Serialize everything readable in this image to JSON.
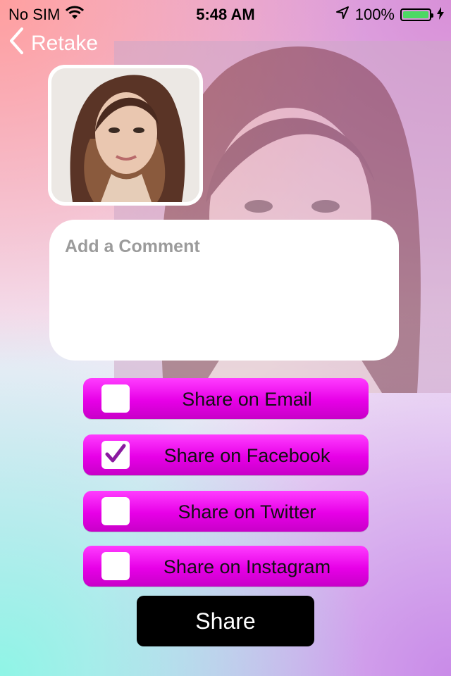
{
  "status": {
    "carrier": "No SIM",
    "time": "5:48 AM",
    "battery": "100%",
    "battery_level": 1.0
  },
  "nav": {
    "back_label": "Retake"
  },
  "comment": {
    "placeholder": "Add a Comment",
    "value": ""
  },
  "options": [
    {
      "label": "Share on Email",
      "checked": false
    },
    {
      "label": "Share on Facebook",
      "checked": true
    },
    {
      "label": "Share on Twitter",
      "checked": false
    },
    {
      "label": "Share on Instagram",
      "checked": false
    }
  ],
  "share_button": {
    "label": "Share"
  },
  "colors": {
    "accent": "#e700e7",
    "check": "#8a1aa0"
  }
}
